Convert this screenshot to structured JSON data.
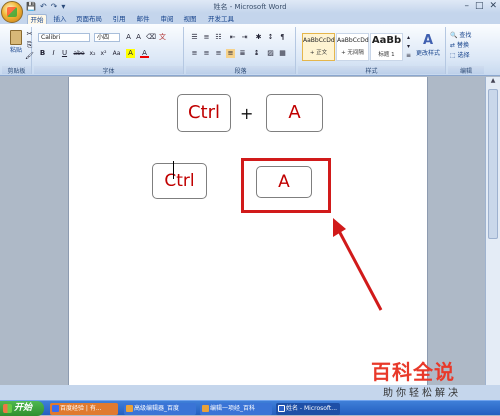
{
  "window": {
    "title": "姓名 - Microsoft Word",
    "controls": [
      "–",
      "□",
      "✕"
    ]
  },
  "quick_access": [
    "💾",
    "↶",
    "↷",
    "▾"
  ],
  "tabs": [
    "开始",
    "插入",
    "页面布局",
    "引用",
    "邮件",
    "审阅",
    "视图",
    "开发工具"
  ],
  "ribbon": {
    "clipboard": {
      "paste_label": "粘贴",
      "group": "剪贴板"
    },
    "font": {
      "font_name": "Calibri",
      "font_size": "小四",
      "group": "字体",
      "buttons": [
        "B",
        "I",
        "U",
        "abe",
        "x₂",
        "x²",
        "Aa",
        "A",
        "A"
      ]
    },
    "paragraph": {
      "group": "段落"
    },
    "styles": {
      "group": "样式",
      "items": [
        {
          "sample": "AaBbCcDd",
          "name": "+ 正文"
        },
        {
          "sample": "AaBbCcDd",
          "name": "+ 无间隔"
        },
        {
          "sample": "AaBb",
          "name": "标题 1"
        }
      ],
      "change_label": "更改样式"
    },
    "editing": {
      "group": "编辑",
      "items": [
        "查找",
        "替换",
        "选择"
      ]
    }
  },
  "document": {
    "top_keys": {
      "first": "Ctrl",
      "plus": "+",
      "second": "A"
    },
    "bottom_keys": {
      "first": "Ctrl",
      "second": "A"
    }
  },
  "taskbar": {
    "start": "开始",
    "tasks": [
      "百度经验 | 有...",
      "高级编辑器_百度",
      "编辑一项经_百科",
      "姓名 - Microsoft..."
    ]
  },
  "watermark": {
    "line1": "百科全说",
    "line2": "助你轻松解决"
  },
  "colors": {
    "key_text": "#c00000",
    "highlight_box": "#d11a1a",
    "arrow": "#d11a1a"
  }
}
